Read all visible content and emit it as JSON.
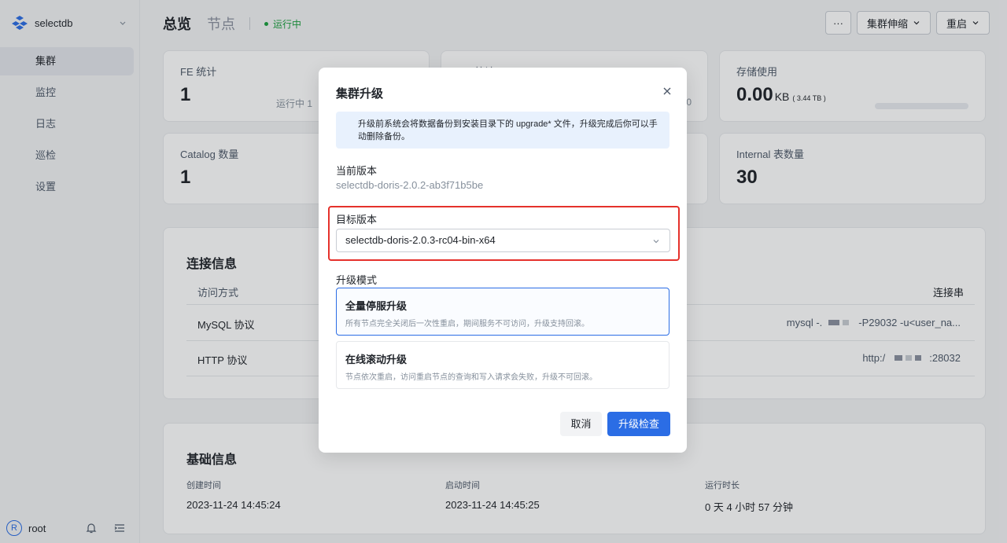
{
  "app": {
    "name": "selectdb",
    "user_initial": "R",
    "user": "root"
  },
  "sidebar": {
    "items": [
      {
        "label": "集群"
      },
      {
        "label": "监控"
      },
      {
        "label": "日志"
      },
      {
        "label": "巡检"
      },
      {
        "label": "设置"
      }
    ]
  },
  "header": {
    "title": "总览",
    "tab": "节点",
    "status": "运行中",
    "more_label": "···",
    "scale_label": "集群伸缩",
    "restart_label": "重启"
  },
  "stats": {
    "fe_label": "FE 统计",
    "fe_value": "1",
    "fe_running": "运行中 1",
    "be_label": "BE 统计",
    "be_tail": "0",
    "storage_label": "存储使用",
    "storage_value": "0.00",
    "storage_unit": "KB",
    "storage_total": "( 3.44 TB )",
    "storage_used_fraction": 0.0,
    "catalog_label": "Catalog 数量",
    "catalog_value": "1",
    "internal_label": "Internal 表数量",
    "internal_value": "30"
  },
  "connection": {
    "title": "连接信息",
    "col_method": "访问方式",
    "col_conn": "连接串",
    "rows": [
      {
        "method": "MySQL 协议",
        "prefix": "mysql -.",
        "suffix": "-P29032 -u<user_na..."
      },
      {
        "method": "HTTP 协议",
        "prefix": "http:/",
        "suffix": ":28032"
      }
    ]
  },
  "basic": {
    "title": "基础信息",
    "created_label": "创建时间",
    "created_value": "2023-11-24 14:45:24",
    "started_label": "启动时间",
    "started_value": "2023-11-24 14:45:25",
    "uptime_label": "运行时长",
    "uptime_value": "0 天 4 小时 57 分钟"
  },
  "modal": {
    "title": "集群升级",
    "alert": "升级前系统会将数据备份到安装目录下的 upgrade* 文件，升级完成后你可以手动删除备份。",
    "current_label": "当前版本",
    "current_value": "selectdb-doris-2.0.2-ab3f71b5be",
    "target_label": "目标版本",
    "target_value": "selectdb-doris-2.0.3-rc04-bin-x64",
    "mode_label": "升级模式",
    "mode_full_title": "全量停服升级",
    "mode_full_desc": "所有节点完全关闭后一次性重启，期间服务不可访问，升级支持回滚。",
    "mode_rolling_title": "在线滚动升级",
    "mode_rolling_desc": "节点依次重启，访问重启节点的查询和写入请求会失败，升级不可回滚。",
    "cancel_label": "取消",
    "confirm_label": "升级检查"
  },
  "colors": {
    "accent": "#2b6de5",
    "success": "#1a9f3d",
    "highlight": "#e5312b"
  }
}
